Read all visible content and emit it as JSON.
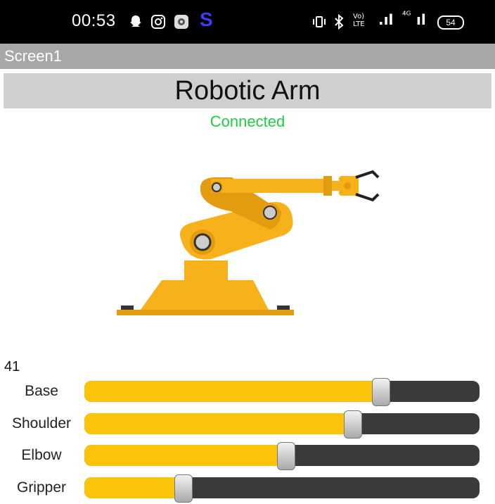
{
  "status_bar": {
    "time": "00:53",
    "s_label": "S",
    "right_vol": "Vo)",
    "right_lte": "LTE",
    "right_signal1": ".ıl",
    "right_net": "⁴ᴳ",
    "right_signal2": "ıl",
    "battery": "54"
  },
  "app": {
    "window_title": "Screen1",
    "header_title": "Robotic Arm",
    "connection_status": "Connected",
    "status_color": "#22cc44"
  },
  "value_display": "41",
  "sliders": [
    {
      "label": "Base",
      "value": 0.75
    },
    {
      "label": "Shoulder",
      "value": 0.68
    },
    {
      "label": "Elbow",
      "value": 0.51
    },
    {
      "label": "Gripper",
      "value": 0.25
    }
  ],
  "colors": {
    "accent": "#fcc30b",
    "arm_yellow": "#f7b21b",
    "arm_dark": "#e39b10",
    "track": "#3a3a3a"
  },
  "icons": {
    "notification_1": "snapchat-icon",
    "notification_2": "instagram-icon",
    "notification_3": "settings-icon",
    "illustration": "robotic-arm-illustration"
  }
}
